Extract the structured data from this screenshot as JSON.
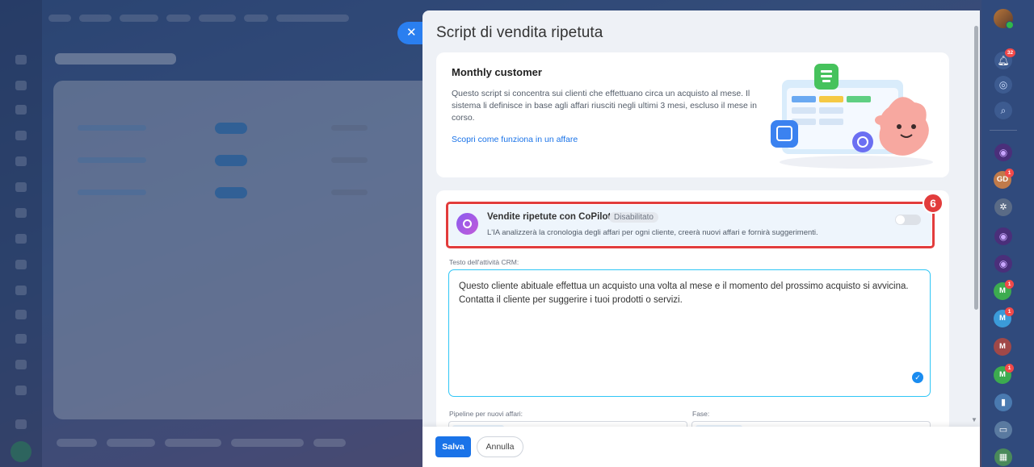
{
  "slider": {
    "title": "Script di vendita ripetuta",
    "close_icon": "close-icon"
  },
  "info_card": {
    "title": "Monthly customer",
    "description": "Questo script si concentra sui clienti che effettuano circa un acquisto al mese. Il sistema li definisce in base agli affari riusciti negli ultimi 3 mesi, escluso il mese in corso.",
    "link": "Scopri come funziona in un affare"
  },
  "copilot": {
    "title": "Vendite ripetute con CoPilot",
    "status": "Disabilitato",
    "description": "L'IA analizzerà la cronologia degli affari per ogni cliente, creerà nuovi affari e fornirà suggerimenti.",
    "enabled": false,
    "step_badge": "6"
  },
  "activity": {
    "label": "Testo dell'attività CRM:",
    "text": "Questo cliente abituale effettua un acquisto una volta al mese e il momento del prossimo acquisto si avvicina. Contatta il cliente per suggerire i tuoi prodotti o servizi."
  },
  "fields": {
    "pipeline_label": "Pipeline per nuovi affari:",
    "stage_label": "Fase:"
  },
  "footer": {
    "save": "Salva",
    "cancel": "Annulla"
  },
  "right_rail": {
    "notifications_count": "32",
    "avatars": [
      {
        "initials": "GD",
        "badge": "1",
        "color": "#c07a4a"
      },
      {
        "initials": "M",
        "badge": "1",
        "color": "#3cab4f"
      },
      {
        "initials": "M",
        "badge": "1",
        "color": "#3b9bd9"
      },
      {
        "initials": "M",
        "badge": "",
        "color": "#a04848"
      },
      {
        "initials": "M",
        "badge": "1",
        "color": "#3cab4f"
      }
    ]
  },
  "colors": {
    "accent": "#1a73e8",
    "highlight": "#e23c3c",
    "copilot": "#8a5cf0"
  }
}
